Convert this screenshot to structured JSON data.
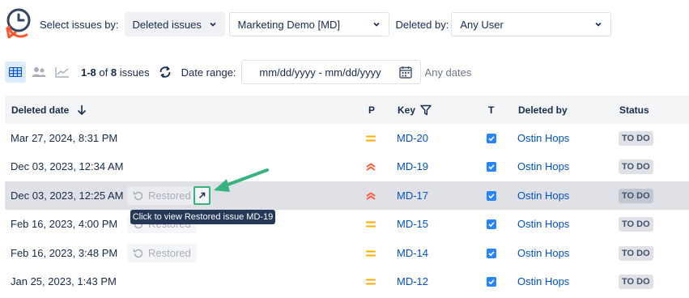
{
  "filters": {
    "select_label": "Select issues by:",
    "issues_type": "Deleted issues",
    "project": "Marketing Demo [MD]",
    "deleted_by_label": "Deleted by:",
    "deleted_by": "Any User"
  },
  "toolbar": {
    "range_text": "1-8",
    "of_text": "of",
    "total": "8",
    "issues_word": "issues",
    "date_range_label": "Date range:",
    "date_range_value": "mm/dd/yyyy - mm/dd/yyyy",
    "any_dates": "Any dates"
  },
  "table": {
    "headers": {
      "deleted_date": "Deleted date",
      "priority": "P",
      "key": "Key",
      "type": "T",
      "deleted_by": "Deleted by",
      "status": "Status"
    },
    "rows": [
      {
        "date": "Mar 27, 2024, 8:31 PM",
        "restored": "",
        "priority": "medium",
        "key": "MD-20",
        "user": "Ostin Hops",
        "status": "TO DO"
      },
      {
        "date": "Dec 03, 2023, 12:34 AM",
        "restored": "",
        "priority": "high",
        "key": "MD-19",
        "user": "Ostin Hops",
        "status": "TO DO"
      },
      {
        "date": "Dec 03, 2023, 12:25 AM",
        "restored": "Restored",
        "priority": "high",
        "key": "MD-17",
        "user": "Ostin Hops",
        "status": "TO DO"
      },
      {
        "date": "Feb 16, 2023, 4:00 PM",
        "restored": "Restored",
        "priority": "medium",
        "key": "MD-15",
        "user": "Ostin Hops",
        "status": "TO DO"
      },
      {
        "date": "Feb 16, 2023, 3:48 PM",
        "restored": "Restored",
        "priority": "medium",
        "key": "MD-14",
        "user": "Ostin Hops",
        "status": "TO DO"
      },
      {
        "date": "Jan 25, 2023, 1:43 PM",
        "restored": "",
        "priority": "medium",
        "key": "MD-12",
        "user": "Ostin Hops",
        "status": "TO DO"
      }
    ]
  },
  "tooltip": {
    "text": "Click to view Restored issue MD-19"
  },
  "colors": {
    "priority_medium": "#ffab00",
    "priority_high": "#ff5630",
    "link": "#0052cc",
    "annotation": "#36b37e",
    "selected_row": "#dfe1e6"
  }
}
